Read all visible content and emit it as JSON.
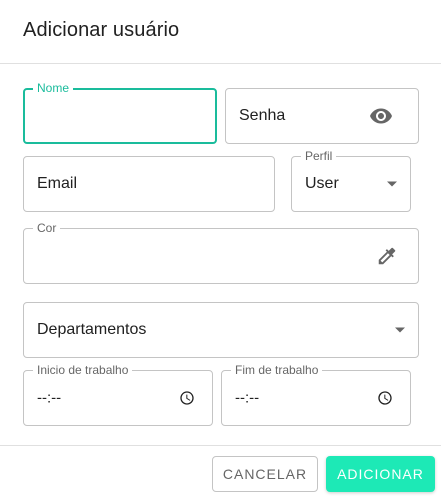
{
  "dialog": {
    "title": "Adicionar usuário"
  },
  "form": {
    "nome": {
      "label": "Nome",
      "value": ""
    },
    "senha": {
      "placeholder": "Senha",
      "value": "",
      "icon": "eye-icon"
    },
    "email": {
      "placeholder": "Email",
      "value": ""
    },
    "perfil": {
      "label": "Perfil",
      "selected": "User",
      "icon": "dropdown-arrow-icon"
    },
    "cor": {
      "label": "Cor",
      "value": "",
      "icon": "eyedropper-icon"
    },
    "departamentos": {
      "placeholder": "Departamentos",
      "icon": "dropdown-arrow-icon"
    },
    "inicio_trabalho": {
      "label": "Inicio de trabalho",
      "value": "--:--",
      "icon": "clock-icon"
    },
    "fim_trabalho": {
      "label": "Fim de trabalho",
      "value": "--:--",
      "icon": "clock-icon"
    }
  },
  "actions": {
    "cancel_label": "CANCELAR",
    "add_label": "ADICIONAR"
  },
  "colors": {
    "accent": "#1abc9c",
    "primary_button": "#1de9b6",
    "border": "#c4c4c4",
    "text": "#212121",
    "muted": "#666666"
  }
}
